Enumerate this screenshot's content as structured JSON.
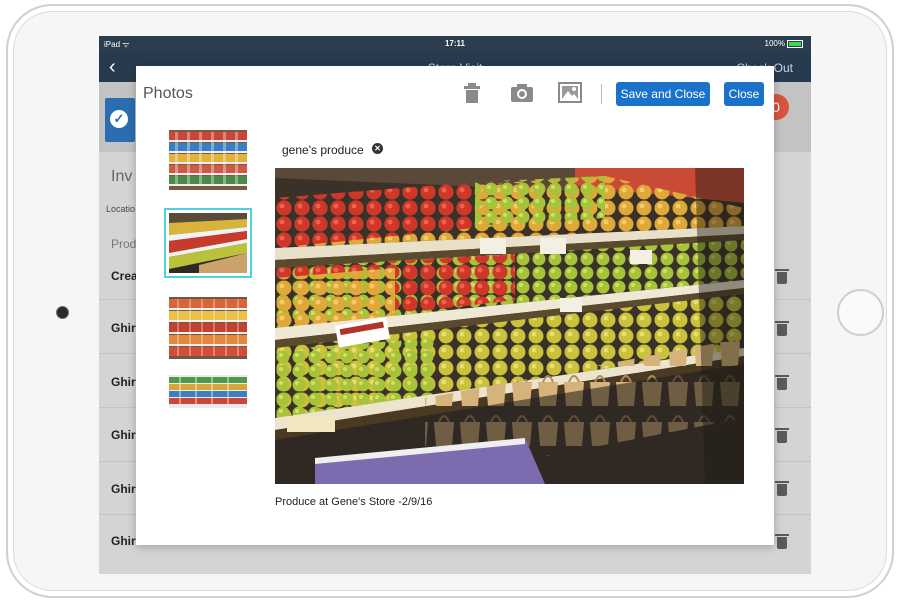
{
  "status_bar": {
    "left": "iPad ᯤ",
    "time": "17:11",
    "battery": "100%"
  },
  "nav": {
    "back": "‹",
    "title": "Store Visit",
    "right": "Check Out"
  },
  "background": {
    "badge": "0",
    "section_title": "Inv",
    "location_label": "Locatio",
    "products_label": "Prod",
    "rows": [
      "Crea",
      "Ghir",
      "Ghir",
      "Ghir",
      "Ghir",
      "Ghir"
    ]
  },
  "modal": {
    "title": "Photos",
    "toolbar": {
      "delete_icon": "trash-icon",
      "camera_icon": "camera-icon",
      "gallery_icon": "image-icon",
      "save_label": "Save and Close",
      "close_label": "Close"
    },
    "thumbnails": [
      {
        "name": "shelf-products",
        "selected": false
      },
      {
        "name": "produce",
        "selected": true
      },
      {
        "name": "shelf-bottles",
        "selected": false
      },
      {
        "name": "shelf-wide",
        "selected": false
      }
    ],
    "photo": {
      "tag": "gene's produce",
      "caption": "Produce at Gene's Store -2/9/16"
    }
  },
  "colors": {
    "accent": "#1b73c9",
    "nav": "#263b4f",
    "selection": "#4fd1e0"
  }
}
